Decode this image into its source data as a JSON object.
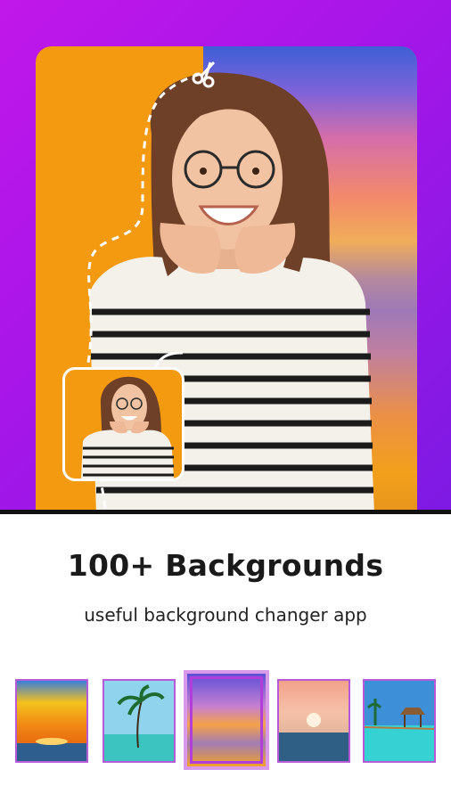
{
  "hero": {
    "accent_color": "#b316e8",
    "left_color": "#f39a11",
    "scissor_icon": "scissors-icon"
  },
  "headline": "100+ Backgrounds",
  "subline": "useful background changer app",
  "backgrounds": [
    {
      "name": "golden-sunset-sea",
      "selected": false
    },
    {
      "name": "palm-tree-lagoon",
      "selected": false
    },
    {
      "name": "purple-sunset-sea",
      "selected": true
    },
    {
      "name": "pink-sun-ocean",
      "selected": false
    },
    {
      "name": "tropical-pier",
      "selected": false
    }
  ]
}
